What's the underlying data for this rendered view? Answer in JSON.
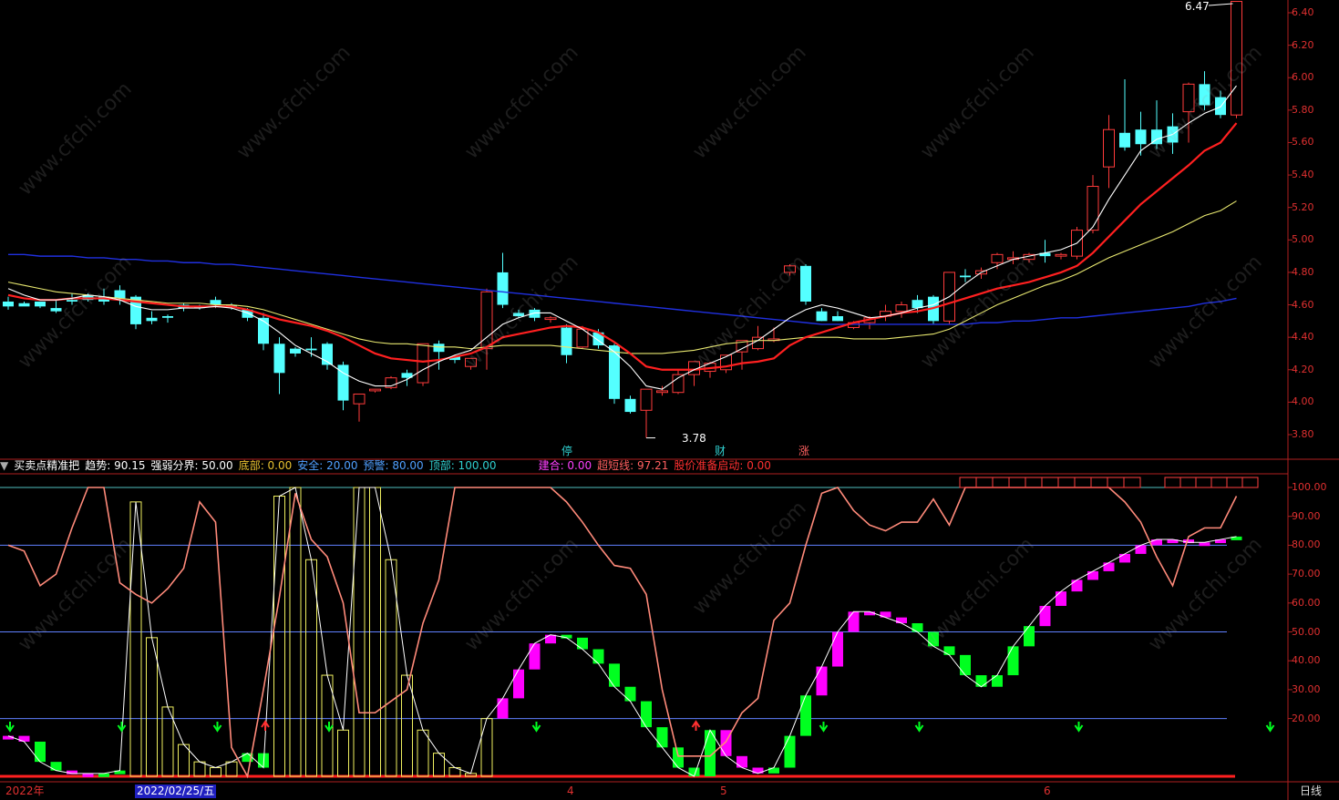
{
  "price_axis": [
    "6.40",
    "6.20",
    "6.00",
    "5.80",
    "5.60",
    "5.40",
    "5.20",
    "5.00",
    "4.80",
    "4.60",
    "4.40",
    "4.20",
    "4.00",
    "3.80"
  ],
  "indicator_axis": [
    "100.00",
    "90.00",
    "80.00",
    "70.00",
    "60.00",
    "50.00",
    "40.00",
    "30.00",
    "20.00"
  ],
  "annotations": {
    "high": "6.47",
    "low": "3.78"
  },
  "event_tags": [
    {
      "text": "停",
      "color": "#30d0d0"
    },
    {
      "text": "财",
      "color": "#30d0d0"
    },
    {
      "text": "涨",
      "color": "#ff6060"
    }
  ],
  "indicator": {
    "name": "买卖点精准把",
    "trend": "趋势: 90.15",
    "divide": "强弱分界: 50.00",
    "bottom": "底部: 0.00",
    "safe": "安全: 20.00",
    "warn": "预警: 80.00",
    "top": "顶部: 100.00",
    "build": "建合: 0.00",
    "ultra": "超短线: 97.21",
    "start": "股价准备启动: 0.00"
  },
  "time_axis": {
    "year": "2022年",
    "cursor_date": "2022/02/25/五",
    "months": [
      "4",
      "5",
      "6"
    ],
    "period": "日线"
  },
  "watermark": "www.cfchi.com",
  "colors": {
    "up": "#ff3b3b",
    "down": "#54ffff",
    "ma_fast": "#ffffff",
    "ma_mid": "#ff2020",
    "ma_slow": "#e8e870",
    "ma_long": "#2030e0",
    "pink": "#ff00ff",
    "green": "#00ff20"
  },
  "chart_data": {
    "type": "candlestick",
    "candles": [
      [
        4.62,
        4.65,
        4.59,
        4.57
      ],
      [
        4.61,
        4.62,
        4.59,
        4.6
      ],
      [
        4.62,
        4.62,
        4.59,
        4.58
      ],
      [
        4.58,
        4.63,
        4.56,
        4.55
      ],
      [
        4.63,
        4.67,
        4.62,
        4.6
      ],
      [
        4.66,
        4.67,
        4.63,
        4.62
      ],
      [
        4.65,
        4.7,
        4.62,
        4.6
      ],
      [
        4.69,
        4.72,
        4.64,
        4.6
      ],
      [
        4.65,
        4.66,
        4.48,
        4.45
      ],
      [
        4.52,
        4.56,
        4.5,
        4.48
      ],
      [
        4.53,
        4.54,
        4.52,
        4.49
      ],
      [
        4.6,
        4.61,
        4.58,
        4.56
      ],
      [
        4.59,
        4.6,
        4.58,
        4.57
      ],
      [
        4.63,
        4.65,
        4.6,
        4.58
      ],
      [
        4.6,
        4.61,
        4.59,
        4.57
      ],
      [
        4.57,
        4.58,
        4.52,
        4.5
      ],
      [
        4.52,
        4.55,
        4.36,
        4.32
      ],
      [
        4.36,
        4.4,
        4.18,
        4.05
      ],
      [
        4.33,
        4.34,
        4.3,
        4.28
      ],
      [
        4.33,
        4.4,
        4.32,
        4.28
      ],
      [
        4.36,
        4.37,
        4.23,
        4.2
      ],
      [
        4.23,
        4.25,
        4.01,
        3.95
      ],
      [
        3.99,
        4.04,
        4.05,
        3.88
      ],
      [
        4.07,
        4.07,
        4.08,
        4.06
      ],
      [
        4.09,
        4.16,
        4.15,
        4.08
      ],
      [
        4.18,
        4.2,
        4.15,
        4.1
      ],
      [
        4.12,
        4.18,
        4.36,
        4.1
      ],
      [
        4.36,
        4.38,
        4.31,
        4.2
      ],
      [
        4.28,
        4.29,
        4.26,
        4.24
      ],
      [
        4.22,
        4.26,
        4.27,
        4.2
      ],
      [
        4.33,
        4.7,
        4.68,
        4.2
      ],
      [
        4.8,
        4.92,
        4.6,
        4.58
      ],
      [
        4.55,
        4.57,
        4.53,
        4.52
      ],
      [
        4.57,
        4.58,
        4.52,
        4.5
      ],
      [
        4.51,
        4.53,
        4.52,
        4.49
      ],
      [
        4.46,
        4.48,
        4.29,
        4.24
      ],
      [
        4.34,
        4.47,
        4.45,
        4.33
      ],
      [
        4.43,
        4.45,
        4.35,
        4.33
      ],
      [
        4.35,
        4.36,
        4.02,
        3.99
      ],
      [
        4.02,
        4.04,
        3.94,
        3.93
      ],
      [
        3.95,
        4.04,
        4.08,
        3.78
      ],
      [
        4.06,
        4.1,
        4.07,
        4.04
      ],
      [
        4.06,
        4.2,
        4.17,
        4.05
      ],
      [
        4.17,
        4.25,
        4.25,
        4.1
      ],
      [
        4.19,
        4.25,
        4.24,
        4.15
      ],
      [
        4.2,
        4.25,
        4.29,
        4.18
      ],
      [
        4.31,
        4.34,
        4.38,
        4.2
      ],
      [
        4.33,
        4.47,
        4.4,
        4.32
      ],
      [
        4.38,
        4.46,
        4.39,
        4.37
      ],
      [
        4.8,
        4.85,
        4.84,
        4.78
      ],
      [
        4.84,
        4.85,
        4.62,
        4.6
      ],
      [
        4.56,
        4.58,
        4.5,
        4.5
      ],
      [
        4.53,
        4.56,
        4.5,
        4.5
      ],
      [
        4.46,
        4.5,
        4.49,
        4.45
      ],
      [
        4.49,
        4.53,
        4.52,
        4.45
      ],
      [
        4.53,
        4.6,
        4.56,
        4.5
      ],
      [
        4.56,
        4.62,
        4.6,
        4.52
      ],
      [
        4.63,
        4.66,
        4.58,
        4.55
      ],
      [
        4.65,
        4.66,
        4.5,
        4.48
      ],
      [
        4.5,
        4.8,
        4.8,
        4.48
      ],
      [
        4.78,
        4.82,
        4.77,
        4.74
      ],
      [
        4.79,
        4.83,
        4.81,
        4.76
      ],
      [
        4.86,
        4.92,
        4.91,
        4.82
      ],
      [
        4.88,
        4.93,
        4.89,
        4.85
      ],
      [
        4.88,
        4.92,
        4.91,
        4.86
      ],
      [
        4.92,
        5.0,
        4.9,
        4.86
      ],
      [
        4.9,
        4.92,
        4.91,
        4.88
      ],
      [
        4.9,
        5.08,
        5.06,
        4.88
      ],
      [
        5.06,
        5.4,
        5.33,
        5.04
      ],
      [
        5.45,
        5.77,
        5.68,
        5.32
      ],
      [
        5.66,
        5.99,
        5.57,
        5.55
      ],
      [
        5.68,
        5.79,
        5.59,
        5.52
      ],
      [
        5.68,
        5.86,
        5.59,
        5.56
      ],
      [
        5.7,
        5.78,
        5.6,
        5.53
      ],
      [
        5.79,
        5.97,
        5.96,
        5.6
      ],
      [
        5.96,
        6.04,
        5.83,
        5.8
      ],
      [
        5.88,
        5.92,
        5.77,
        5.75
      ],
      [
        5.77,
        6.47,
        6.47,
        5.75
      ]
    ],
    "ma_fast": [
      4.7,
      4.66,
      4.63,
      4.63,
      4.64,
      4.66,
      4.65,
      4.63,
      4.59,
      4.57,
      4.57,
      4.58,
      4.58,
      4.59,
      4.58,
      4.55,
      4.5,
      4.43,
      4.35,
      4.3,
      4.25,
      4.18,
      4.13,
      4.1,
      4.1,
      4.14,
      4.2,
      4.25,
      4.29,
      4.32,
      4.4,
      4.48,
      4.52,
      4.55,
      4.55,
      4.5,
      4.45,
      4.38,
      4.31,
      4.22,
      4.1,
      4.08,
      4.15,
      4.2,
      4.24,
      4.28,
      4.33,
      4.38,
      4.45,
      4.52,
      4.57,
      4.6,
      4.58,
      4.55,
      4.52,
      4.53,
      4.55,
      4.58,
      4.6,
      4.65,
      4.73,
      4.8,
      4.84,
      4.88,
      4.9,
      4.92,
      4.94,
      4.98,
      5.08,
      5.25,
      5.4,
      5.55,
      5.62,
      5.65,
      5.72,
      5.78,
      5.82,
      5.95
    ],
    "ma_mid": [
      4.66,
      4.64,
      4.63,
      4.63,
      4.64,
      4.64,
      4.64,
      4.63,
      4.62,
      4.61,
      4.6,
      4.59,
      4.59,
      4.59,
      4.59,
      4.57,
      4.54,
      4.51,
      4.49,
      4.47,
      4.44,
      4.4,
      4.35,
      4.3,
      4.27,
      4.26,
      4.25,
      4.26,
      4.28,
      4.3,
      4.34,
      4.4,
      4.42,
      4.44,
      4.46,
      4.47,
      4.46,
      4.43,
      4.37,
      4.3,
      4.22,
      4.2,
      4.2,
      4.2,
      4.21,
      4.22,
      4.24,
      4.25,
      4.27,
      4.35,
      4.4,
      4.43,
      4.46,
      4.49,
      4.51,
      4.53,
      4.55,
      4.56,
      4.58,
      4.61,
      4.64,
      4.67,
      4.7,
      4.72,
      4.74,
      4.77,
      4.8,
      4.84,
      4.92,
      5.02,
      5.12,
      5.22,
      5.3,
      5.38,
      5.46,
      5.55,
      5.6,
      5.72
    ],
    "ma_slow": [
      4.74,
      4.72,
      4.7,
      4.68,
      4.67,
      4.66,
      4.65,
      4.64,
      4.63,
      4.62,
      4.61,
      4.61,
      4.61,
      4.6,
      4.6,
      4.59,
      4.57,
      4.54,
      4.51,
      4.48,
      4.45,
      4.42,
      4.39,
      4.37,
      4.36,
      4.36,
      4.35,
      4.34,
      4.34,
      4.33,
      4.34,
      4.35,
      4.35,
      4.35,
      4.35,
      4.34,
      4.33,
      4.32,
      4.31,
      4.3,
      4.3,
      4.3,
      4.31,
      4.32,
      4.34,
      4.36,
      4.37,
      4.38,
      4.38,
      4.39,
      4.4,
      4.4,
      4.4,
      4.39,
      4.39,
      4.39,
      4.4,
      4.41,
      4.42,
      4.45,
      4.5,
      4.55,
      4.6,
      4.64,
      4.68,
      4.72,
      4.75,
      4.79,
      4.84,
      4.89,
      4.93,
      4.97,
      5.01,
      5.05,
      5.1,
      5.15,
      5.18,
      5.24
    ],
    "ma_long": [
      4.91,
      4.91,
      4.9,
      4.9,
      4.9,
      4.89,
      4.89,
      4.88,
      4.88,
      4.87,
      4.87,
      4.86,
      4.86,
      4.85,
      4.85,
      4.84,
      4.83,
      4.82,
      4.81,
      4.8,
      4.79,
      4.78,
      4.77,
      4.76,
      4.75,
      4.74,
      4.73,
      4.72,
      4.71,
      4.7,
      4.69,
      4.68,
      4.67,
      4.66,
      4.65,
      4.64,
      4.63,
      4.62,
      4.61,
      4.6,
      4.59,
      4.58,
      4.57,
      4.56,
      4.55,
      4.54,
      4.53,
      4.52,
      4.51,
      4.5,
      4.49,
      4.48,
      4.48,
      4.48,
      4.48,
      4.48,
      4.48,
      4.48,
      4.48,
      4.48,
      4.48,
      4.49,
      4.49,
      4.5,
      4.5,
      4.51,
      4.52,
      4.52,
      4.53,
      4.54,
      4.55,
      4.56,
      4.57,
      4.58,
      4.59,
      4.61,
      4.62,
      4.64
    ],
    "osc_bars": [
      14,
      12,
      5,
      2,
      1,
      1,
      1,
      2,
      95,
      48,
      24,
      11,
      5,
      3,
      5,
      8,
      3,
      97,
      100,
      75,
      35,
      16,
      100,
      100,
      75,
      35,
      16,
      8,
      3,
      1,
      20,
      27,
      37,
      46,
      49,
      48,
      44,
      39,
      31,
      26,
      17,
      10,
      3,
      0,
      16,
      7,
      3,
      1,
      3,
      14,
      28,
      38,
      50,
      57,
      57,
      55,
      53,
      50,
      45,
      42,
      35,
      31,
      35,
      45,
      52,
      59,
      64,
      68,
      71,
      74,
      77,
      80,
      82,
      82,
      81,
      81,
      82,
      83,
      85,
      89
    ],
    "osc_colors": "ppggppggyyyyyyyggyyyyyyyyyyyyyyppppggggggggggpppgggppppppggggggggppppppppppppggppp",
    "red_line": [
      80,
      78,
      66,
      70,
      86,
      100,
      100,
      67,
      63,
      60,
      65,
      72,
      95,
      88,
      10,
      0,
      30,
      62,
      98,
      82,
      76,
      60,
      22,
      22,
      26,
      30,
      53,
      68,
      100,
      100,
      100,
      100,
      100,
      100,
      100,
      95,
      88,
      80,
      73,
      72,
      63,
      30,
      7,
      7,
      7,
      12,
      22,
      27,
      54,
      60,
      80,
      98,
      100,
      92,
      87,
      85,
      88,
      88,
      96,
      87,
      100,
      100,
      100,
      100,
      100,
      100,
      100,
      100,
      100,
      100,
      95,
      88,
      76,
      66,
      83,
      86,
      86,
      97
    ],
    "down_arrows": [
      0,
      7,
      13,
      20,
      33,
      51,
      57,
      67,
      79
    ],
    "up_arrows": [
      16,
      43
    ],
    "hlines": [
      100,
      80,
      50,
      20
    ],
    "xlabel": "",
    "ylabel": ""
  }
}
